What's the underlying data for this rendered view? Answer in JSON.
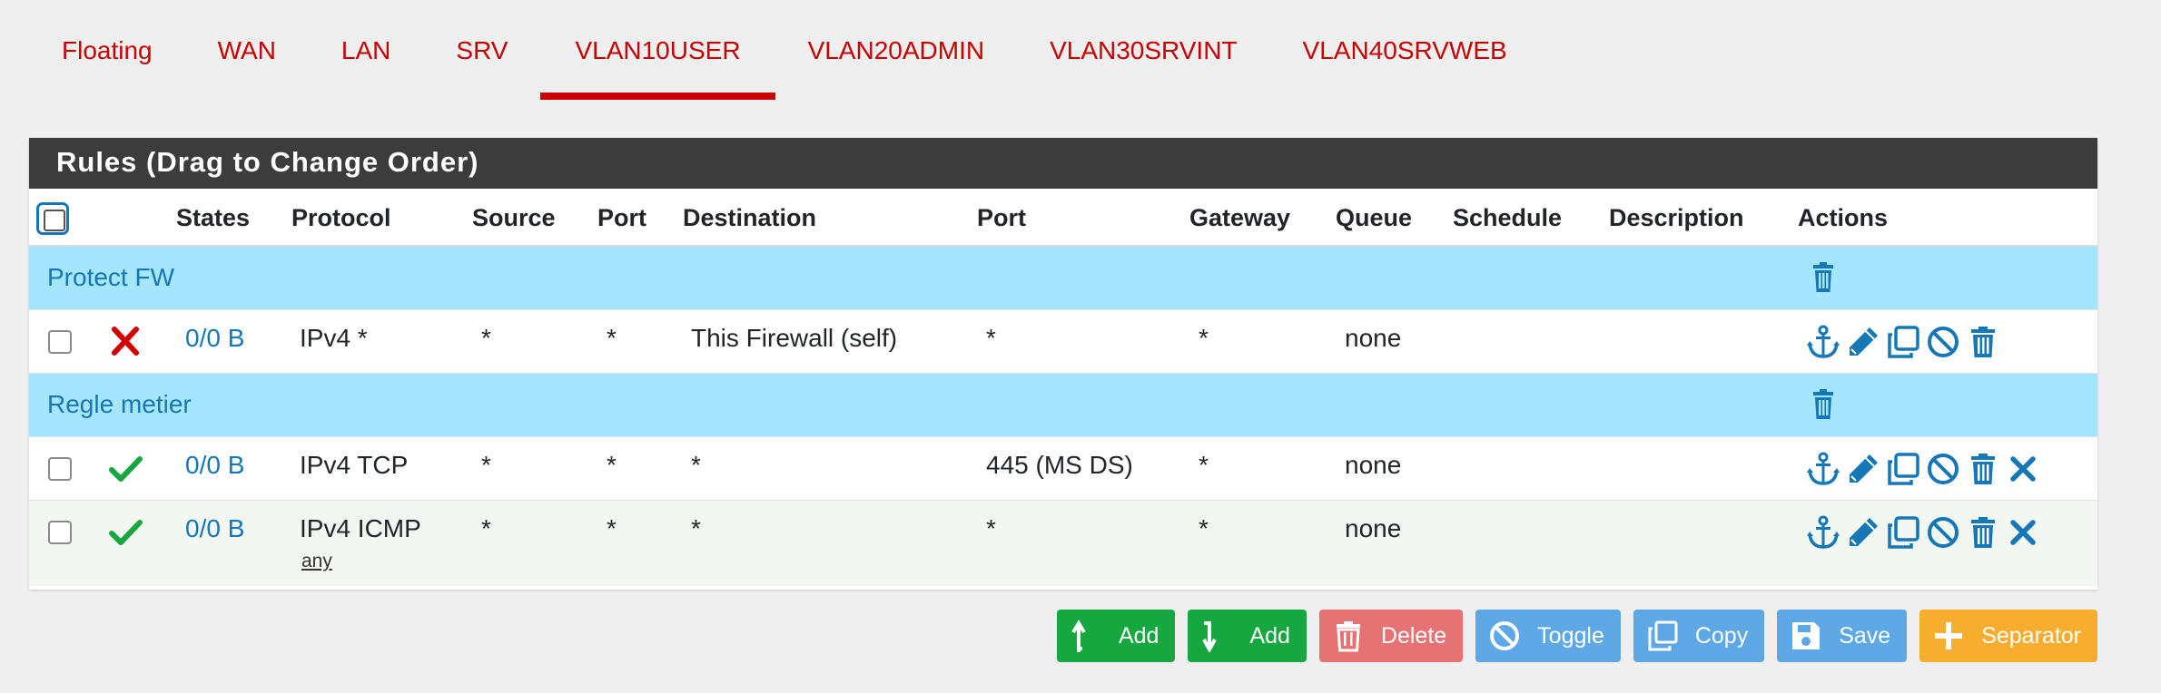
{
  "tabs": [
    {
      "label": "Floating",
      "active": false
    },
    {
      "label": "WAN",
      "active": false
    },
    {
      "label": "LAN",
      "active": false
    },
    {
      "label": "SRV",
      "active": false
    },
    {
      "label": "VLAN10USER",
      "active": true
    },
    {
      "label": "VLAN20ADMIN",
      "active": false
    },
    {
      "label": "VLAN30SRVINT",
      "active": false
    },
    {
      "label": "VLAN40SRVWEB",
      "active": false
    }
  ],
  "panel": {
    "title": "Rules (Drag to Change Order)"
  },
  "columns": {
    "states": "States",
    "protocol": "Protocol",
    "source": "Source",
    "sport": "Port",
    "destination": "Destination",
    "dport": "Port",
    "gateway": "Gateway",
    "queue": "Queue",
    "schedule": "Schedule",
    "description": "Description",
    "actions": "Actions"
  },
  "separators": [
    {
      "label": "Protect FW"
    },
    {
      "label": "Regle metier"
    }
  ],
  "rules": [
    {
      "status": "block",
      "states": "0/0 B",
      "protocol": "IPv4 *",
      "protocol_sub": "",
      "source": "*",
      "sport": "*",
      "destination": "This Firewall (self)",
      "dport": "*",
      "gateway": "*",
      "queue": "none",
      "schedule": "",
      "description": ""
    },
    {
      "status": "pass",
      "states": "0/0 B",
      "protocol": "IPv4 TCP",
      "protocol_sub": "",
      "source": "*",
      "sport": "*",
      "destination": "*",
      "dport": "445 (MS DS)",
      "gateway": "*",
      "queue": "none",
      "schedule": "",
      "description": ""
    },
    {
      "status": "pass",
      "states": "0/0 B",
      "protocol": "IPv4 ICMP",
      "protocol_sub": "any",
      "source": "*",
      "sport": "*",
      "destination": "*",
      "dport": "*",
      "gateway": "*",
      "queue": "none",
      "schedule": "",
      "description": ""
    }
  ],
  "buttons": {
    "add_top": "Add",
    "add_bottom": "Add",
    "delete": "Delete",
    "toggle": "Toggle",
    "copy": "Copy",
    "save": "Save",
    "separator": "Separator"
  },
  "icons": {
    "anchor": "anchor-icon",
    "edit": "pencil-icon",
    "copy": "copy-icon",
    "disable": "ban-icon",
    "delete": "trash-icon",
    "remove": "close-icon"
  },
  "colors": {
    "accent": "#c80000",
    "link": "#1577b5",
    "separator_bg": "#a6e6fc",
    "pass": "#16a741",
    "block": "#d00000",
    "header_bg": "#3c3c3c"
  }
}
